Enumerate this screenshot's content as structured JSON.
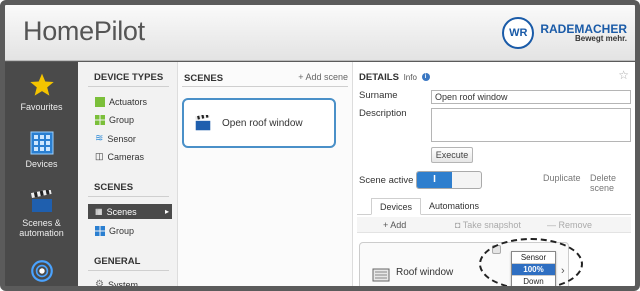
{
  "app": {
    "title": "HomePilot",
    "brand_name": "RADEMACHER",
    "slogan": "Bewegt mehr.",
    "brand_color": "#1a5ba8"
  },
  "nav": [
    {
      "label": "Favourites",
      "icon": "star-icon"
    },
    {
      "label": "Devices",
      "icon": "devices-icon"
    },
    {
      "label": "Scenes & automation",
      "icon": "clapper-icon"
    },
    {
      "label": "",
      "icon": "sensor-icon"
    }
  ],
  "device_types": {
    "title": "DEVICE TYPES",
    "items": [
      {
        "label": "Actuators",
        "icon": "actuator-icon"
      },
      {
        "label": "Group",
        "icon": "group-icon"
      },
      {
        "label": "Sensor",
        "icon": "wifi-icon"
      },
      {
        "label": "Cameras",
        "icon": "camera-icon"
      }
    ]
  },
  "scenes_section": {
    "title": "SCENES",
    "items": [
      {
        "label": "Scenes",
        "icon": "clapper-icon",
        "active": true
      },
      {
        "label": "Group",
        "icon": "group-icon"
      }
    ]
  },
  "general_section": {
    "title": "GENERAL",
    "items": [
      {
        "label": "System",
        "icon": "gear-icon"
      }
    ]
  },
  "scenes": {
    "title": "SCENES",
    "add_label": "+ Add scene",
    "cards": [
      {
        "label": "Open roof window"
      }
    ]
  },
  "details": {
    "title": "DETAILS",
    "info_label": "Info",
    "surname_label": "Surname",
    "surname_value": "Open roof window",
    "description_label": "Description",
    "description_value": "",
    "execute_label": "Execute",
    "scene_active_label": "Scene active",
    "toggle_label": "I",
    "duplicate_label": "Duplicate",
    "delete_label": "Delete scene",
    "tabs": [
      "Devices",
      "Automations"
    ],
    "toolbar": {
      "add": "+ Add",
      "snapshot": "Take snapshot",
      "remove": "Remove"
    },
    "devices": [
      {
        "name": "Roof window",
        "options": [
          "Sensor",
          "100%",
          "Down"
        ],
        "selected": "100%"
      }
    ]
  }
}
